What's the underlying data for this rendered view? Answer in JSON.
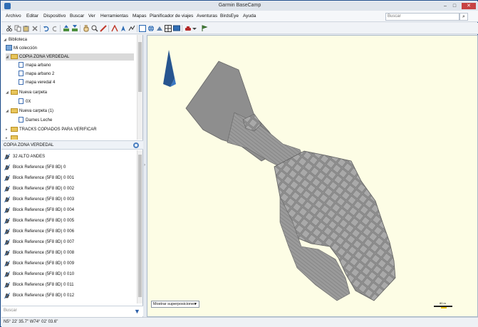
{
  "window": {
    "title": "Garmin BaseCamp",
    "minimize_glyph": "–",
    "maximize_glyph": "□",
    "close_glyph": "✕"
  },
  "menu": [
    "Archivo",
    "Editar",
    "Dispositivo",
    "Buscar",
    "Ver",
    "Herramientas",
    "Mapas",
    "Planificador de viajes",
    "Aventuras",
    "BirdsEye",
    "Ayuda"
  ],
  "search": {
    "placeholder": "Buscar",
    "button_glyph": "⌕"
  },
  "toolbar": {
    "icons": [
      "cut-icon",
      "copy-icon",
      "paste-icon",
      "delete-icon",
      "undo-icon",
      "redo-icon",
      "receive-icon",
      "send-icon",
      "hand-icon",
      "zoom-icon",
      "measure-icon",
      "text-icon",
      "waypoint-icon",
      "route-icon",
      "map-view-icon",
      "globe-icon",
      "3d-icon",
      "grid-icon",
      "screen-icon",
      "car-icon",
      "dropdown-icon",
      "flag-icon"
    ],
    "accent": "#2f6db5"
  },
  "library": {
    "title": "Biblioteca",
    "root": "Mi colección",
    "items": [
      {
        "label": "COPIA ZONA VERDEDAL",
        "type": "folder",
        "level": 1,
        "selected": true
      },
      {
        "label": "mapa arbano",
        "type": "doc",
        "level": 2
      },
      {
        "label": "mapa arbano 2",
        "type": "doc",
        "level": 2
      },
      {
        "label": "mapa veredal 4",
        "type": "doc",
        "level": 2
      },
      {
        "label": "Nueva carpeta",
        "type": "folder",
        "level": 1
      },
      {
        "label": "0X",
        "type": "doc",
        "level": 2
      },
      {
        "label": "Nueva carpeta (1)",
        "type": "folder",
        "level": 1
      },
      {
        "label": "Darnes Leche",
        "type": "doc",
        "level": 2
      },
      {
        "label": "TRACKS COPIADOS PARA VERIFICAR",
        "type": "folder",
        "level": 1
      }
    ]
  },
  "panel": {
    "title": "COPIA ZONA VERDEDAL",
    "rows": [
      "32 ALTO ANDES",
      "Block Reference (5F8 8D) 0",
      "Block Reference (5F8 8D) 0 001",
      "Block Reference (5F8 8D) 0 002",
      "Block Reference (5F8 8D) 0 003",
      "Block Reference (5F8 8D) 0 004",
      "Block Reference (5F8 8D) 0 005",
      "Block Reference (5F8 8D) 0 006",
      "Block Reference (5F8 8D) 0 007",
      "Block Reference (5F8 8D) 0 008",
      "Block Reference (5F8 8D) 0 009",
      "Block Reference (5F8 8D) 0 010",
      "Block Reference (5F8 8D) 0 011",
      "Block Reference (5F8 8D) 0 012"
    ],
    "filter_placeholder": "Buscar"
  },
  "map": {
    "overlay_label": "Mostrar superposiciones",
    "scale_label": "80 m",
    "background": "#fdfde5",
    "shape_color": "#8c8c8c"
  },
  "status": {
    "coords": "N5° 22' 35.7\" W74° 02' 03.6\""
  }
}
